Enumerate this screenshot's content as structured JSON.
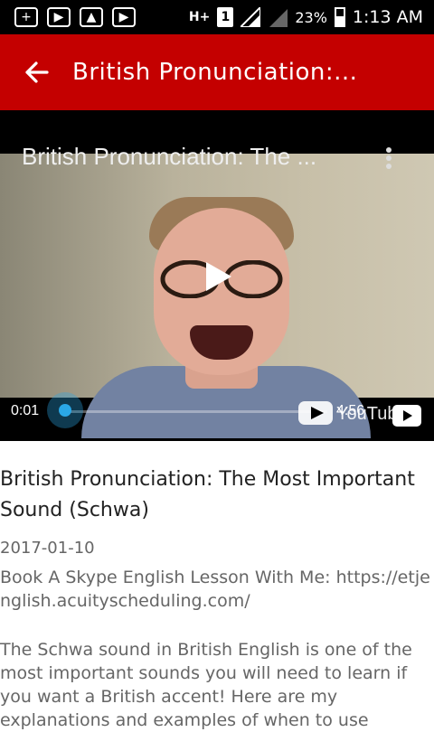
{
  "status_bar": {
    "time": "1:13 AM",
    "battery": "23%",
    "network": "H+",
    "sim": "1",
    "left_icons": [
      "plus-square-icon",
      "youtube-icon",
      "image-icon",
      "youtube-icon"
    ]
  },
  "appbar": {
    "title": "British Pronunciation:..."
  },
  "video": {
    "overlay_title": "British Pronunciation: The ...",
    "current_time": "0:01",
    "duration": "4:56",
    "progress": 0.0,
    "logo_text": "YouTube"
  },
  "content": {
    "title": "British Pronunciation: The Most Important Sound (Schwa)",
    "date": "2017-01-10",
    "description_line1": "Book A Skype English Lesson With Me: https://etjenglish.acuityscheduling.com/",
    "description_line2": "The Schwa sound in British English is one of the most important sounds you will need to learn if you want a British accent! Here are my explanations and examples of when to use"
  },
  "colors": {
    "appbar": "#c40000",
    "accent": "#2aa7e6"
  }
}
